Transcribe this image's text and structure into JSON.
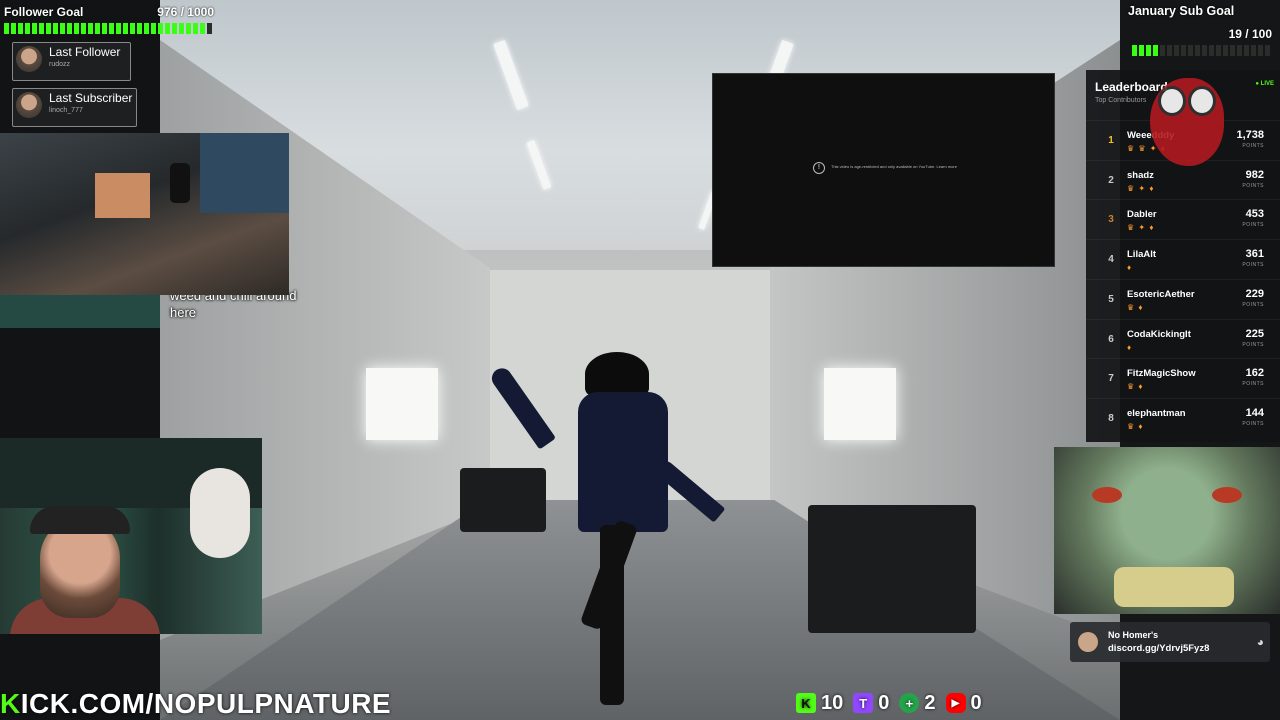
{
  "follower_goal": {
    "title": "Follower Goal",
    "count": "976 / 1000",
    "progress": 0.976
  },
  "last_follower": {
    "label": "Last Follower",
    "name": "rudozz"
  },
  "last_subscriber": {
    "label": "Last Subscriber",
    "name": "linoch_777"
  },
  "chat_snippet": "g in my\nw bud.\ns chat\nmoke\nweed and chill around\nhere",
  "video_error": "This video is age-restricted and only available on YouTube. Learn more",
  "kick_url": {
    "first": "K",
    "rest": "ICK.COM/NOPULPNATURE"
  },
  "counters": [
    {
      "name": "kick",
      "value": "10",
      "color": "#53fc18",
      "icon": "K"
    },
    {
      "name": "twitch",
      "value": "0",
      "color": "#9146ff",
      "icon": "T"
    },
    {
      "name": "rumble",
      "value": "2",
      "color": "#24a34a",
      "icon": "+"
    },
    {
      "name": "youtube",
      "value": "0",
      "color": "#ff0000",
      "icon": "▶"
    }
  ],
  "sub_goal": {
    "title": "January Sub Goal",
    "count": "19 / 100",
    "progress": 0.19
  },
  "leaderboard": {
    "title": "Leaderboard",
    "subtitle": "Top Contributors",
    "live": "● LIVE",
    "points_label": "POINTS",
    "rows": [
      {
        "rank": "1",
        "name": "Weeedddy",
        "points": "1,738",
        "badges": "♛ ♛ ✦ ♦",
        "rank_color": "#f2c230"
      },
      {
        "rank": "2",
        "name": "shadz",
        "points": "982",
        "badges": "♛ ✦ ♦",
        "rank_color": "#c8c8c8"
      },
      {
        "rank": "3",
        "name": "Dabler",
        "points": "453",
        "badges": "♛ ✦ ♦",
        "rank_color": "#cd7f32"
      },
      {
        "rank": "4",
        "name": "LilaAlt",
        "points": "361",
        "badges": "♦",
        "rank_color": "#cccccc"
      },
      {
        "rank": "5",
        "name": "EsotericAether",
        "points": "229",
        "badges": "♛ ♦",
        "rank_color": "#cccccc"
      },
      {
        "rank": "6",
        "name": "CodaKickingIt",
        "points": "225",
        "badges": "♦",
        "rank_color": "#cccccc"
      },
      {
        "rank": "7",
        "name": "FitzMagicShow",
        "points": "162",
        "badges": "♛ ♦",
        "rank_color": "#cccccc"
      },
      {
        "rank": "8",
        "name": "elephantman",
        "points": "144",
        "badges": "♛ ♦",
        "rank_color": "#cccccc"
      }
    ]
  },
  "discord": {
    "name": "No Homer's",
    "link": "discord.gg/Ydrvj5Fyz8"
  },
  "colors": {
    "accent": "#53fc18"
  }
}
